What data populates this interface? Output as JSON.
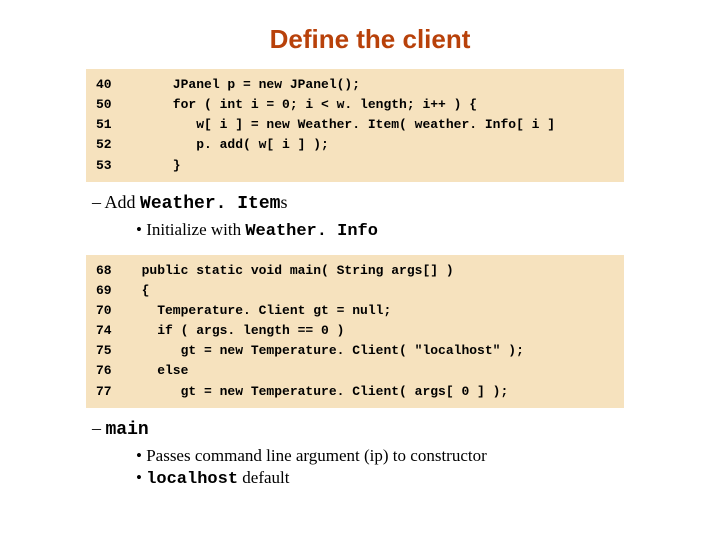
{
  "title": "Define the client",
  "code1": {
    "lines": [
      {
        "n": "40",
        "t": "      JPanel p = new JPanel();"
      },
      {
        "n": "50",
        "t": "      for ( int i = 0; i < w. length; i++ ) {"
      },
      {
        "n": "51",
        "t": "         w[ i ] = new Weather. Item( weather. Info[ i ]"
      },
      {
        "n": "52",
        "t": "         p. add( w[ i ] );"
      },
      {
        "n": "53",
        "t": "      }"
      }
    ]
  },
  "bullet1": {
    "pre": "Add ",
    "mono": "Weather. Item",
    "post": "s"
  },
  "sub1": {
    "items": [
      {
        "pre": "Initialize with ",
        "mono": "Weather. Info",
        "post": ""
      }
    ]
  },
  "code2": {
    "lines": [
      {
        "n": "68",
        "t": "  public static void main( String args[] )"
      },
      {
        "n": "69",
        "t": "  {"
      },
      {
        "n": "70",
        "t": "    Temperature. Client gt = null;"
      },
      {
        "n": "74",
        "t": "    if ( args. length == 0 )"
      },
      {
        "n": "75",
        "t": "       gt = new Temperature. Client( \"localhost\" );"
      },
      {
        "n": "76",
        "t": "    else"
      },
      {
        "n": "77",
        "t": "       gt = new Temperature. Client( args[ 0 ] );"
      }
    ]
  },
  "bullet2": {
    "pre": "",
    "mono": "main",
    "post": ""
  },
  "sub2": {
    "items": [
      {
        "pre": "Passes command line argument (ip) to constructor",
        "mono": "",
        "post": ""
      },
      {
        "pre": "",
        "mono": "localhost",
        "post": " default"
      }
    ]
  }
}
